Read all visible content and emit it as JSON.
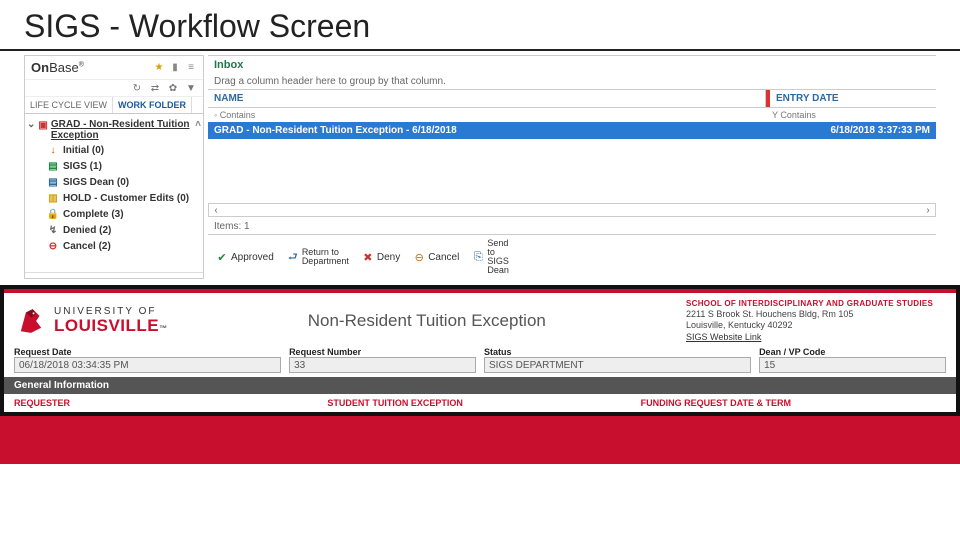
{
  "slide": {
    "title": "SIGS - Workflow Screen"
  },
  "brand": {
    "name_pre": "On",
    "name_post": "Base"
  },
  "tabs": {
    "lifecycle": "LIFE CYCLE VIEW",
    "workfolder": "WORK FOLDER"
  },
  "tree": {
    "root": "GRAD - Non-Resident Tuition Exception",
    "items": [
      {
        "label": "Initial (0)"
      },
      {
        "label": "SIGS (1)"
      },
      {
        "label": "SIGS Dean (0)"
      },
      {
        "label": "HOLD - Customer Edits (0)"
      },
      {
        "label": "Complete (3)"
      },
      {
        "label": "Denied (2)"
      },
      {
        "label": "Cancel (2)"
      }
    ]
  },
  "inbox": {
    "title": "Inbox",
    "group_hint": "Drag a column header here to group by that column.",
    "col_name": "NAME",
    "col_entry": "ENTRY DATE",
    "filter_hint_a": "◦  Contains",
    "filter_hint_b": "Y    Contains",
    "row_name": "GRAD - Non-Resident Tuition Exception - 6/18/2018",
    "row_date": "6/18/2018 3:37:33 PM",
    "items_label": "Items: 1"
  },
  "actions": {
    "approved": "Approved",
    "return1": "Return to",
    "return2": "Department",
    "deny": "Deny",
    "cancel": "Cancel",
    "send1": "Send",
    "send2": "to",
    "send3": "SIGS",
    "send4": "Dean"
  },
  "form": {
    "uni1": "UNIVERSITY OF",
    "uni2": "LOUISVILLE",
    "title": "Non-Resident Tuition Exception",
    "dept_name": "SCHOOL OF INTERDISCIPLINARY AND GRADUATE STUDIES",
    "dept_addr1": "2211 S Brook St. Houchens Bldg, Rm 105",
    "dept_addr2": "Louisville, Kentucky 40292",
    "dept_link": "SIGS Website Link",
    "fields": {
      "req_date_l": "Request Date",
      "req_date_v": "06/18/2018 03:34:35 PM",
      "req_num_l": "Request Number",
      "req_num_v": "33",
      "status_l": "Status",
      "status_v": "SIGS DEPARTMENT",
      "dean_l": "Dean / VP Code",
      "dean_v": "15"
    },
    "section": "General Information",
    "cols": {
      "a": "REQUESTER",
      "b": "STUDENT TUITION EXCEPTION",
      "c": "FUNDING REQUEST DATE & TERM"
    }
  }
}
